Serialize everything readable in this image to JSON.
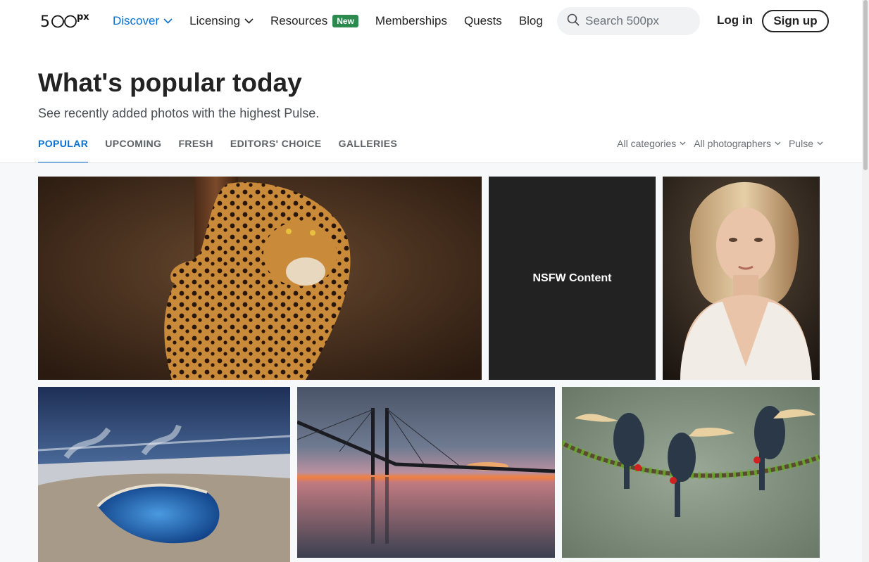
{
  "header": {
    "logo_text": "500px",
    "nav": [
      {
        "label": "Discover",
        "has_dropdown": true,
        "active": true
      },
      {
        "label": "Licensing",
        "has_dropdown": true,
        "active": false
      },
      {
        "label": "Resources",
        "badge": "New",
        "active": false
      },
      {
        "label": "Memberships",
        "active": false
      },
      {
        "label": "Quests",
        "active": false
      },
      {
        "label": "Blog",
        "active": false
      }
    ],
    "search_placeholder": "Search 500px",
    "login_label": "Log in",
    "signup_label": "Sign up"
  },
  "page": {
    "title": "What's popular today",
    "subtitle": "See recently added photos with the highest Pulse."
  },
  "tabs": [
    {
      "label": "POPULAR",
      "active": true
    },
    {
      "label": "UPCOMING",
      "active": false
    },
    {
      "label": "FRESH",
      "active": false
    },
    {
      "label": "EDITORS' CHOICE",
      "active": false
    },
    {
      "label": "GALLERIES",
      "active": false
    }
  ],
  "filters": {
    "category": "All categories",
    "photographer": "All photographers",
    "sort": "Pulse"
  },
  "gallery": {
    "nsfw_label": "NSFW Content"
  },
  "colors": {
    "accent": "#0870d1",
    "badge": "#2c8a4f",
    "nsfw_bg": "#222222"
  }
}
